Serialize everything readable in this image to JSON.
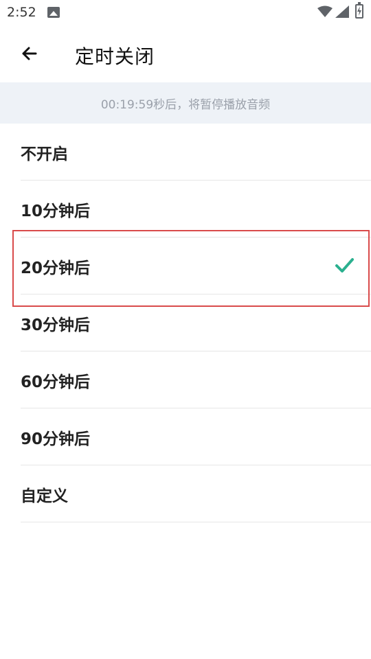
{
  "status_bar": {
    "time": "2:52",
    "icons": [
      "image-icon",
      "wifi-icon",
      "signal-icon",
      "battery-icon"
    ]
  },
  "header": {
    "title": "定时关闭",
    "back_icon": "arrow-left-icon"
  },
  "banner": {
    "text": "00:19:59秒后，将暂停播放音频"
  },
  "options": [
    {
      "label": "不开启",
      "selected": false
    },
    {
      "label": "10分钟后",
      "selected": false
    },
    {
      "label": "20分钟后",
      "selected": true
    },
    {
      "label": "30分钟后",
      "selected": false
    },
    {
      "label": "60分钟后",
      "selected": false
    },
    {
      "label": "90分钟后",
      "selected": false
    },
    {
      "label": "自定义",
      "selected": false
    }
  ],
  "colors": {
    "accent_check": "#2bb08f",
    "banner_bg": "#eef2f7",
    "highlight_border": "#d94a4a"
  }
}
